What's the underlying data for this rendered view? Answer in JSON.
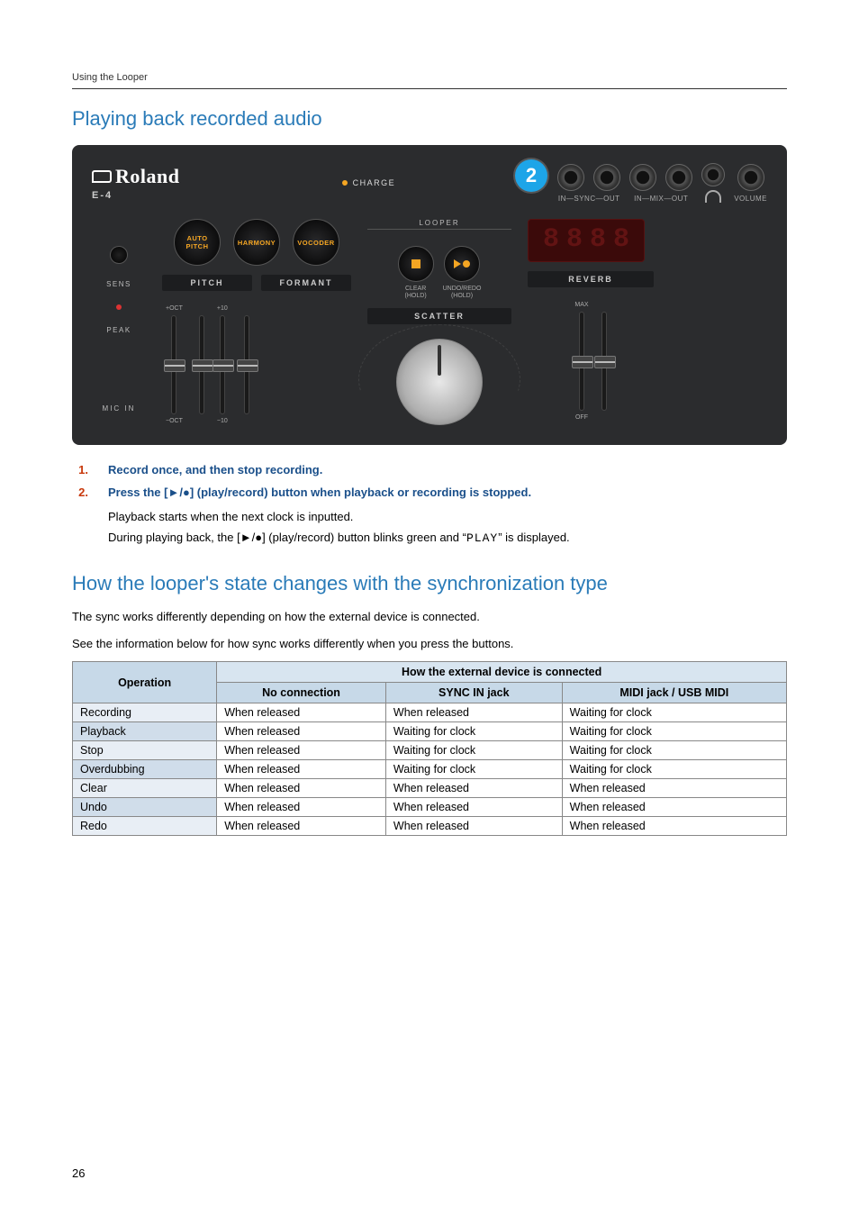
{
  "breadcrumb": "Using the Looper",
  "heading1": "Playing back recorded audio",
  "device": {
    "brand": "Roland",
    "model": "E-4",
    "charge_label": "CHARGE",
    "callout_number": "2",
    "jacks": {
      "sync_in": "IN",
      "sync_mid": "SYNC",
      "sync_out": "OUT",
      "mix_in": "IN",
      "mix_mid": "MIX",
      "mix_out": "OUT",
      "volume": "VOLUME"
    },
    "sens_label": "SENS",
    "peak_label": "PEAK",
    "mic_in_label": "MIC IN",
    "modes": {
      "auto_pitch": "AUTO\nPITCH",
      "harmony": "HARMONY",
      "vocoder": "VOCODER"
    },
    "panel_pitch": "PITCH",
    "panel_formant": "FORMANT",
    "panel_scatter": "SCATTER",
    "panel_reverb": "REVERB",
    "looper_header": "LOOPER",
    "looper_clear": "CLEAR",
    "looper_clear_sub": "(HOLD)",
    "looper_undoredo": "UNDO/REDO",
    "looper_undoredo_sub": "(HOLD)",
    "slider_top_oct": "+OCT",
    "slider_bot_oct": "−OCT",
    "slider_top_10": "+10",
    "slider_bot_10": "−10",
    "slider_max": "MAX",
    "slider_off": "OFF"
  },
  "steps": [
    {
      "num": "1.",
      "text": "Record once, and then stop recording."
    },
    {
      "num": "2.",
      "text_pre": "Press the [",
      "text_post": "] (play/record) button when playback or recording is stopped."
    }
  ],
  "body1": "Playback starts when the next clock is inputted.",
  "body2_pre": "During playing back, the [",
  "body2_mid": "] (play/record) button blinks green and “",
  "body2_seg": "PLAY",
  "body2_post": "” is displayed.",
  "heading2": "How the looper's state changes with the synchronization type",
  "para1": "The sync works differently depending on how the external device is connected.",
  "para2": "See the information below for how sync works differently when you press the buttons.",
  "table": {
    "col_operation": "Operation",
    "col_how": "How the external device is connected",
    "col_none": "No connection",
    "col_sync": "SYNC IN jack",
    "col_midi": "MIDI jack / USB MIDI",
    "rows": [
      {
        "op": "Recording",
        "a": "When released",
        "b": "When released",
        "c": "Waiting for clock"
      },
      {
        "op": "Playback",
        "a": "When released",
        "b": "Waiting for clock",
        "c": "Waiting for clock"
      },
      {
        "op": "Stop",
        "a": "When released",
        "b": "Waiting for clock",
        "c": "Waiting for clock"
      },
      {
        "op": "Overdubbing",
        "a": "When released",
        "b": "Waiting for clock",
        "c": "Waiting for clock"
      },
      {
        "op": "Clear",
        "a": "When released",
        "b": "When released",
        "c": "When released"
      },
      {
        "op": "Undo",
        "a": "When released",
        "b": "When released",
        "c": "When released"
      },
      {
        "op": "Redo",
        "a": "When released",
        "b": "When released",
        "c": "When released"
      }
    ]
  },
  "page_number": "26"
}
